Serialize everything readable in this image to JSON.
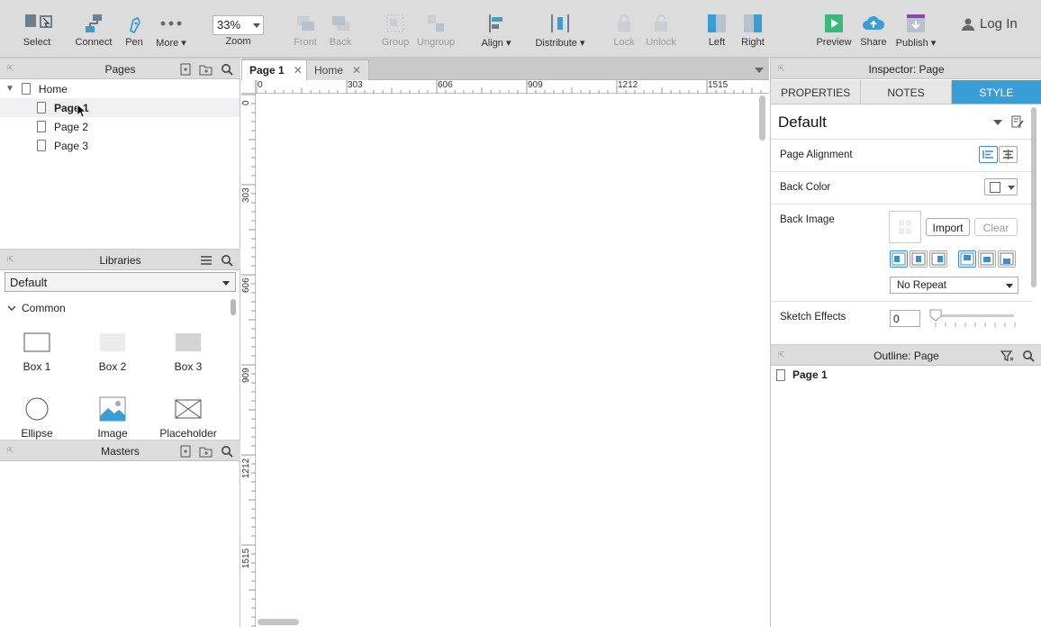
{
  "toolbar": {
    "select": "Select",
    "connect": "Connect",
    "pen": "Pen",
    "more": "More",
    "zoom_value": "33%",
    "zoom_label": "Zoom",
    "front": "Front",
    "back": "Back",
    "group": "Group",
    "ungroup": "Ungroup",
    "align": "Align",
    "distribute": "Distribute",
    "lock": "Lock",
    "unlock": "Unlock",
    "left": "Left",
    "right": "Right",
    "preview": "Preview",
    "share": "Share",
    "publish": "Publish",
    "login": "Log In"
  },
  "pages_panel": {
    "title": "Pages",
    "items": [
      "Home",
      "Page 1",
      "Page 2",
      "Page 3"
    ],
    "selected": "Page 1"
  },
  "libraries_panel": {
    "title": "Libraries",
    "selected_library": "Default",
    "group": "Common",
    "widgets": [
      "Box 1",
      "Box 2",
      "Box 3",
      "Ellipse",
      "Image",
      "Placeholder"
    ]
  },
  "masters_panel": {
    "title": "Masters"
  },
  "canvas": {
    "tabs": [
      {
        "label": "Page 1",
        "active": true
      },
      {
        "label": "Home",
        "active": false
      }
    ],
    "ruler_h": [
      "0",
      "303",
      "606",
      "909",
      "1212",
      "1515"
    ],
    "ruler_v": [
      "0",
      "303",
      "606",
      "909",
      "1212",
      "1515"
    ]
  },
  "inspector": {
    "title": "Inspector: Page",
    "tabs": [
      "PROPERTIES",
      "NOTES",
      "STYLE"
    ],
    "active_tab": "STYLE",
    "style_name": "Default",
    "page_alignment_label": "Page Alignment",
    "back_color_label": "Back Color",
    "back_image_label": "Back Image",
    "import_label": "Import",
    "clear_label": "Clear",
    "repeat_value": "No Repeat",
    "sketch_effects_label": "Sketch Effects",
    "sketch_value": "0"
  },
  "outline": {
    "title": "Outline: Page",
    "item": "Page 1"
  },
  "colors": {
    "accent": "#3a9ed6",
    "toolbar_bg": "#dcdcdc",
    "preview_green": "#3cb878",
    "publish_purple": "#8e44ad"
  }
}
